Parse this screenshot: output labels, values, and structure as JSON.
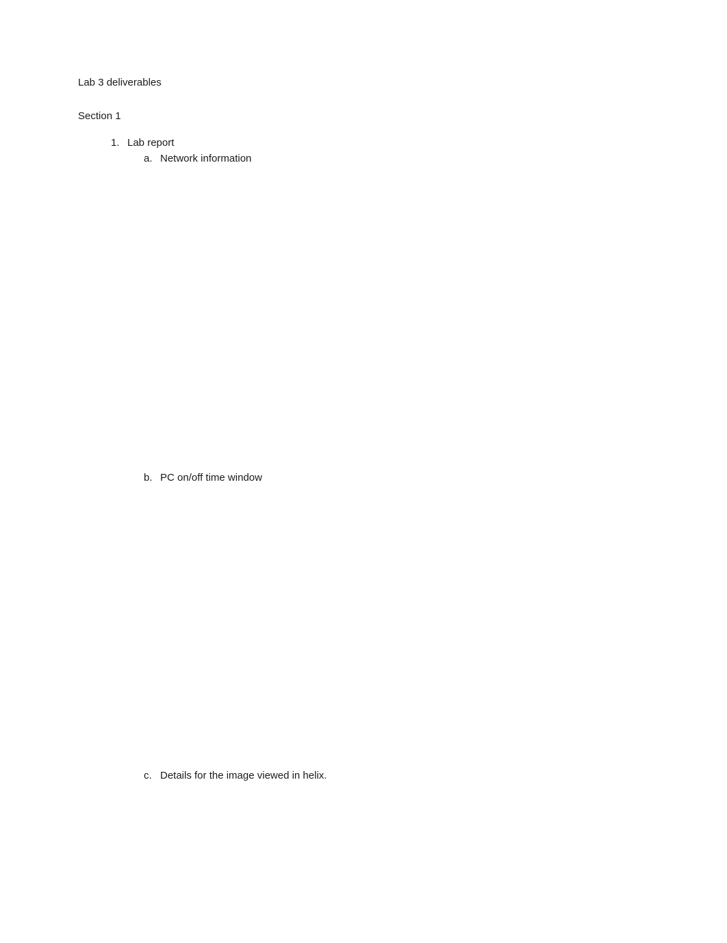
{
  "document": {
    "title": "Lab 3 deliverables",
    "section_heading": "Section 1",
    "list": {
      "items": [
        {
          "marker": "1.",
          "label": "Lab report",
          "children": [
            {
              "marker": "a.",
              "label": "Network information"
            },
            {
              "marker": "b.",
              "label": "PC on/off time window"
            },
            {
              "marker": "c.",
              "label": "Details for the image viewed in helix."
            }
          ]
        }
      ]
    }
  }
}
